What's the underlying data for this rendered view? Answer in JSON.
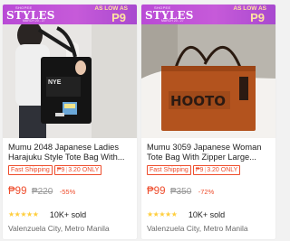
{
  "products": [
    {
      "banner": {
        "top": "SHOPEE",
        "styles": "STYLES",
        "date": "MARCH 20 - 27",
        "as_low_as": "AS LOW AS",
        "promo_price": "P9"
      },
      "title": "Mumu 2048 Japanese Ladies Harajuku Style Tote Bag With...",
      "tag_shipping": "Fast Shipping",
      "tag_pack_price": "₱9",
      "tag_pack_sep": "|",
      "tag_pack_label": "3.20 ONLY",
      "price": "₱99",
      "original_price": "₱220",
      "discount": "-55%",
      "stars": "★★★★★",
      "sold": "10K+ sold",
      "location": "Valenzuela City, Metro Manila",
      "photo_icon": "tote-bag-photo"
    },
    {
      "banner": {
        "top": "SHOPEE",
        "styles": "STYLES",
        "date": "MARCH 20 - 27",
        "as_low_as": "AS LOW AS",
        "promo_price": "P9"
      },
      "title": "Mumu 3059 Japanese Woman Tote Bag With Zipper Large...",
      "tag_shipping": "Fast Shipping",
      "tag_pack_price": "₱9",
      "tag_pack_sep": "|",
      "tag_pack_label": "3.20 ONLY",
      "price": "₱99",
      "original_price": "₱350",
      "discount": "-72%",
      "stars": "★★★★★",
      "sold": "10K+ sold",
      "location": "Valenzuela City, Metro Manila",
      "photo_icon": "tote-bag-photo"
    }
  ],
  "colors": {
    "accent": "#ee4d2d",
    "banner": "#c65ad9",
    "banner_text": "#ffe3a0",
    "star": "#ffce3d"
  }
}
